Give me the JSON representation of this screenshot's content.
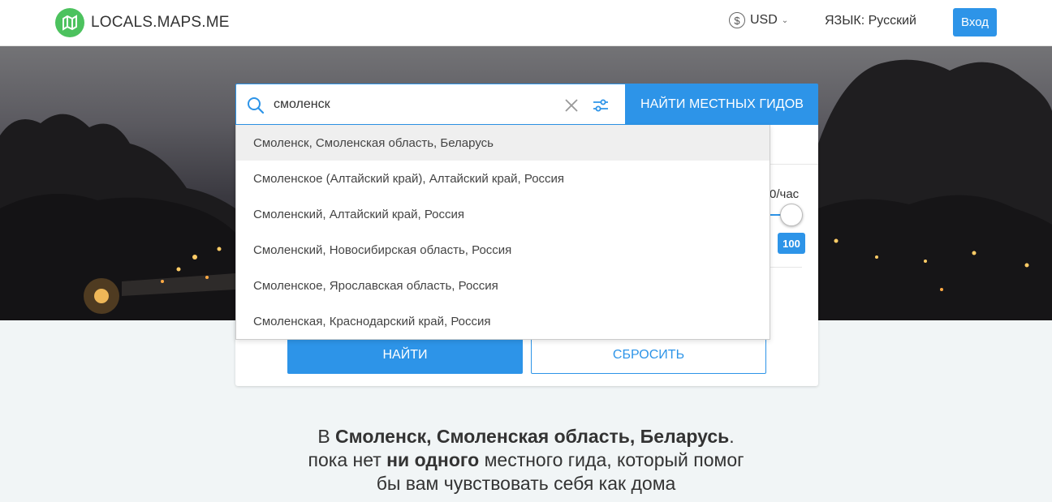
{
  "header": {
    "logo_text": "LOCALS.MAPS.ME",
    "currency_symbol": "$",
    "currency": "USD",
    "language_label": "ЯЗЫК: Русский",
    "login_label": "Вход"
  },
  "search": {
    "query": "смоленск",
    "submit_label": "НАЙТИ МЕСТНЫХ ГИДОВ"
  },
  "suggestions": [
    "Смоленск, Смоленская область, Беларусь",
    "Смоленское (Алтайский край), Алтайский край, Россия",
    "Смоленский, Алтайский край, Россия",
    "Смоленский, Новосибирская область, Россия",
    "Смоленское, Ярославская область, Россия",
    "Смоленская, Краснодарский край, Россия"
  ],
  "filters": {
    "price_label_visible": "0/час",
    "price_max": "100",
    "price_slider_fraction": 1.0,
    "find_label": "НАЙТИ",
    "reset_label": "СБРОСИТЬ"
  },
  "message": {
    "prefix": "В ",
    "place": "Смоленск, Смоленская область, Беларусь",
    "dot": ".",
    "line2_pre": "пока нет ",
    "line2_bold": "ни одного",
    "line2_post": " местного гида, который помог",
    "line3": "бы вам чувствовать себя как дома"
  },
  "colors": {
    "accent": "#2d94e8",
    "logo_green": "#4cc25e",
    "background": "#f1f5f6"
  },
  "icons": [
    "logo-icon",
    "dollar-icon",
    "chevron-down-icon",
    "search-icon",
    "clear-icon",
    "filters-icon"
  ]
}
